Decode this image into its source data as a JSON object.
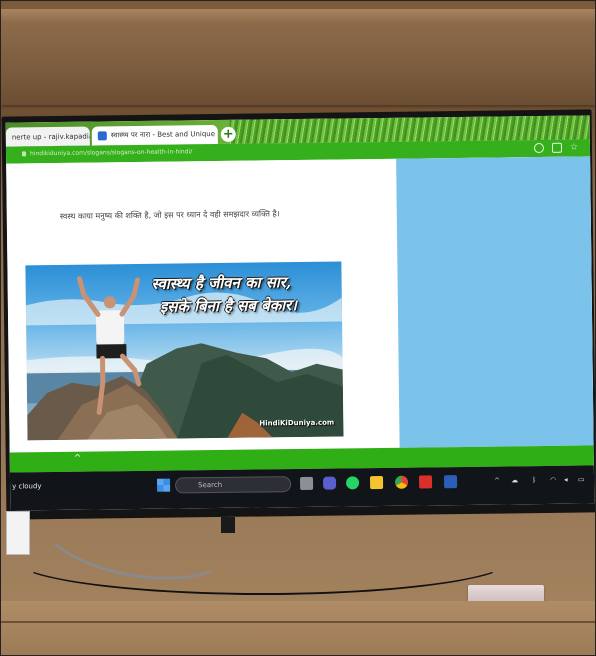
{
  "browser": {
    "tabs": [
      {
        "label": "nerte up - rajiv.kapadia@",
        "close": "×"
      },
      {
        "label": "स्वास्थ्य पर नारा - Best and Unique",
        "close": "×"
      }
    ],
    "new_tab": "+",
    "url": "hindikiduniya.com/slogans/slogans-on-health-in-hindi/"
  },
  "page": {
    "quote": "स्वस्थ काया मनुष्य की शक्ति है, जो इस पर ध्यान दे वही समझदार व्यक्ति है।",
    "image_line1": "स्वास्थ्य है जीवन का सार,",
    "image_line2": "इसके बिना है सब बेकार।",
    "image_brand": "HindiKiDuniya.com"
  },
  "bottom_bar": {
    "line1": "",
    "line2": "",
    "chevron": "^"
  },
  "taskbar": {
    "weather": "y cloudy",
    "search_placeholder": "Search",
    "tray_chevron": "^"
  },
  "colors": {
    "browser_green": "#35b01c",
    "side_panel_blue": "#7cc3ec",
    "taskbar": "#111418"
  }
}
